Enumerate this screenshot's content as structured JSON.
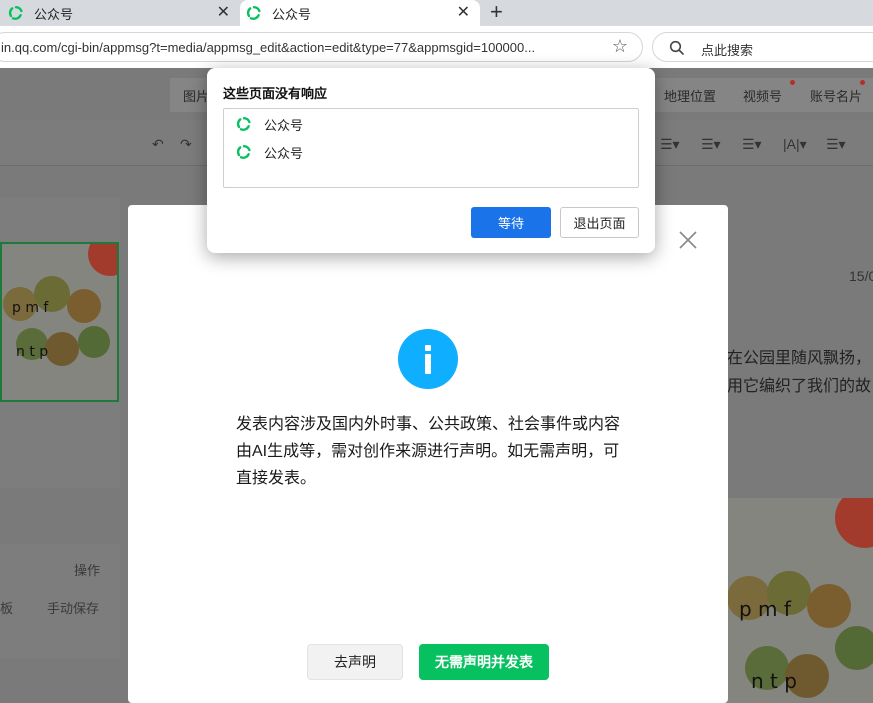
{
  "browser": {
    "tabs": [
      {
        "title": "公众号"
      },
      {
        "title": "公众号"
      }
    ],
    "new_tab_symbol": "+",
    "url": "in.qq.com/cgi-bin/appmsg?t=media/appmsg_edit&action=edit&type=77&appmsgid=100000...",
    "search_placeholder": "点此搜索"
  },
  "editor": {
    "toolbar_items": [
      "图片",
      "地理位置",
      "视频号",
      "账号名片"
    ],
    "left_panel": {
      "header": "操作",
      "row_label_left": "板",
      "row_label_right": "手动保存"
    },
    "article_lines": [
      "在公园里随风飘扬，",
      "用它编织了我们的故"
    ],
    "date_fragment": "15/0"
  },
  "dialog": {
    "message": "发表内容涉及国内外时事、公共政策、社会事件或内容由AI生成等，需对创作来源进行声明。如无需声明，可直接发表。",
    "declare_label": "去声明",
    "publish_label": "无需声明并发表"
  },
  "unresponsive_popup": {
    "title": "这些页面没有响应",
    "pages": [
      "公众号",
      "公众号"
    ],
    "wait_label": "等待",
    "exit_label": "退出页面"
  },
  "colors": {
    "brand_green": "#07c160",
    "info_blue": "#10aeff",
    "wait_blue": "#1a73e8"
  }
}
